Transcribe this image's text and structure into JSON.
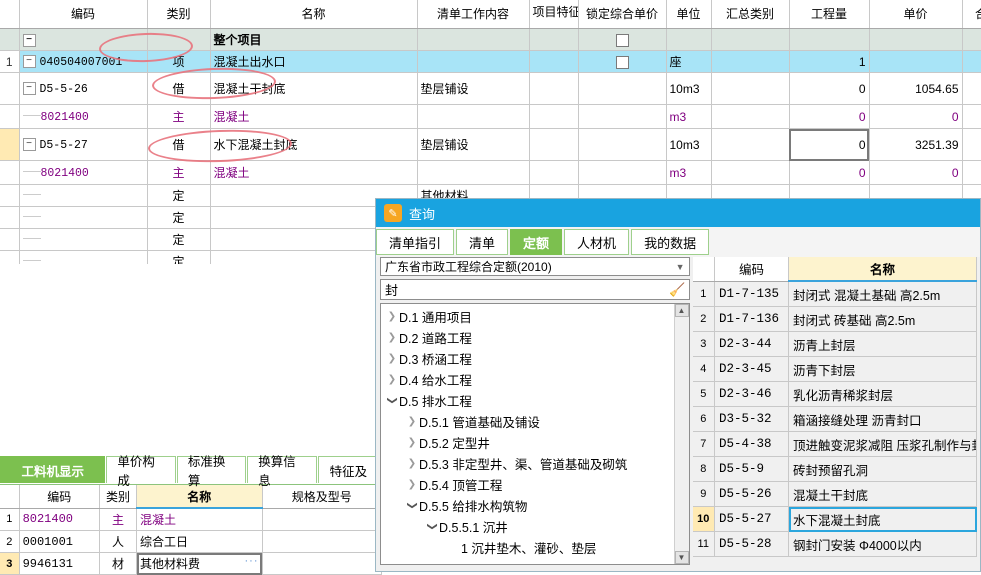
{
  "main_grid": {
    "columns": [
      "",
      "编码",
      "类别",
      "名称",
      "清单工作内容",
      "项目特征",
      "锁定综合单价",
      "单位",
      "汇总类别",
      "工程量",
      "单价",
      "合"
    ],
    "sorted_column": "工程量",
    "rows": [
      {
        "idx": "",
        "code": "",
        "cat": "",
        "name": "整个项目",
        "work": "",
        "unit": "",
        "qty": "",
        "price": "",
        "checkbox": true,
        "style": "total"
      },
      {
        "idx": "1",
        "code": "040504007001",
        "cat": "项",
        "name": "混凝土出水口",
        "work": "",
        "unit": "座",
        "qty": "1",
        "price": "",
        "checkbox": true,
        "style": "sel"
      },
      {
        "idx": "",
        "code": "D5-5-26",
        "cat": "借",
        "name": "混凝土干封底",
        "work": "垫层铺设",
        "unit": "10m3",
        "qty": "0",
        "price": "1054.65",
        "checkbox": false,
        "style": "sub1"
      },
      {
        "idx": "",
        "code": "8021400",
        "cat": "主",
        "name": "混凝土",
        "work": "",
        "unit": "m3",
        "qty": "0",
        "price": "0",
        "checkbox": false,
        "style": "purple"
      },
      {
        "idx": "",
        "code": "D5-5-27",
        "cat": "借",
        "name": "水下混凝土封底",
        "work": "垫层铺设",
        "unit": "10m3",
        "qty": "0",
        "price": "3251.39",
        "checkbox": false,
        "style": "sub1marker"
      },
      {
        "idx": "",
        "code": "8021400",
        "cat": "主",
        "name": "混凝土",
        "work": "",
        "unit": "m3",
        "qty": "0",
        "price": "0",
        "checkbox": false,
        "style": "purple"
      },
      {
        "idx": "",
        "code": "",
        "cat": "定",
        "name": "",
        "work": "其他材料",
        "unit": "",
        "qty": "",
        "price": "",
        "checkbox": false,
        "style": "empty"
      },
      {
        "idx": "",
        "code": "",
        "cat": "定",
        "name": "",
        "work": "",
        "unit": "",
        "qty": "",
        "price": "",
        "checkbox": false,
        "style": "empty"
      },
      {
        "idx": "",
        "code": "",
        "cat": "定",
        "name": "",
        "work": "",
        "unit": "",
        "qty": "",
        "price": "",
        "checkbox": false,
        "style": "empty"
      },
      {
        "idx": "",
        "code": "",
        "cat": "定",
        "name": "",
        "work": "",
        "unit": "",
        "qty": "",
        "price": "",
        "checkbox": false,
        "style": "empty"
      }
    ],
    "selected_cell_value": "0"
  },
  "annotations": {
    "ellipse_1_label": "circle-around-code-040504007001",
    "ellipse_2_label": "circle-around-混凝土干封底",
    "ellipse_3_label": "circle-around-水下混凝土封底"
  },
  "bottom_panel": {
    "tabs": [
      "工料机显示",
      "单价构成",
      "标准换算",
      "换算信息",
      "特征及"
    ],
    "active_tab": "工料机显示",
    "columns": [
      "",
      "编码",
      "类别",
      "名称",
      "规格及型号"
    ],
    "sorted_column": "名称",
    "rows": [
      {
        "idx": "1",
        "code": "8021400",
        "cat": "主",
        "name": "混凝土",
        "spec": "",
        "style": "purple"
      },
      {
        "idx": "2",
        "code": "0001001",
        "cat": "人",
        "name": "综合工日",
        "spec": "",
        "style": "normal"
      },
      {
        "idx": "3",
        "code": "9946131",
        "cat": "材",
        "name": "其他材料费",
        "spec": "",
        "style": "selected"
      }
    ],
    "ellipsis_button": "···"
  },
  "dialog": {
    "title": "查询",
    "icon": "pencil-note-icon",
    "tabs": [
      "清单指引",
      "清单",
      "定额",
      "人材机",
      "我的数据"
    ],
    "active_tab": "定额",
    "library_select": "广东省市政工程综合定额(2010)",
    "search_value": "封",
    "search_clear_icon": "broom-icon",
    "tree": [
      {
        "label": "D.1 通用项目",
        "level": 0,
        "state": "collapsed"
      },
      {
        "label": "D.2 道路工程",
        "level": 0,
        "state": "collapsed"
      },
      {
        "label": "D.3 桥涵工程",
        "level": 0,
        "state": "collapsed"
      },
      {
        "label": "D.4 给水工程",
        "level": 0,
        "state": "collapsed"
      },
      {
        "label": "D.5 排水工程",
        "level": 0,
        "state": "expanded"
      },
      {
        "label": "D.5.1 管道基础及铺设",
        "level": 1,
        "state": "collapsed"
      },
      {
        "label": "D.5.2 定型井",
        "level": 1,
        "state": "collapsed"
      },
      {
        "label": "D.5.3 非定型井、渠、管道基础及砌筑",
        "level": 1,
        "state": "collapsed"
      },
      {
        "label": "D.5.4 顶管工程",
        "level": 1,
        "state": "collapsed"
      },
      {
        "label": "D.5.5 给排水构筑物",
        "level": 1,
        "state": "expanded"
      },
      {
        "label": "D.5.5.1 沉井",
        "level": 2,
        "state": "expanded"
      },
      {
        "label": "1 沉井垫木、灌砂、垫层",
        "level": 3,
        "state": "leaf"
      }
    ],
    "results": {
      "columns": [
        "",
        "编码",
        "名称"
      ],
      "sorted_column": "名称",
      "selected_index": "10",
      "rows": [
        {
          "idx": "1",
          "code": "D1-7-135",
          "name": "封闭式 混凝土基础 高2.5m"
        },
        {
          "idx": "2",
          "code": "D1-7-136",
          "name": "封闭式 砖基础 高2.5m"
        },
        {
          "idx": "3",
          "code": "D2-3-44",
          "name": "沥青上封层"
        },
        {
          "idx": "4",
          "code": "D2-3-45",
          "name": "沥青下封层"
        },
        {
          "idx": "5",
          "code": "D2-3-46",
          "name": "乳化沥青稀浆封层"
        },
        {
          "idx": "6",
          "code": "D3-5-32",
          "name": "箱涵接缝处理 沥青封口"
        },
        {
          "idx": "7",
          "code": "D5-4-38",
          "name": "顶进触变泥浆减阻 压浆孔制作与封"
        },
        {
          "idx": "8",
          "code": "D5-5-9",
          "name": "砖封预留孔洞"
        },
        {
          "idx": "9",
          "code": "D5-5-26",
          "name": "混凝土干封底"
        },
        {
          "idx": "10",
          "code": "D5-5-27",
          "name": "水下混凝土封底"
        },
        {
          "idx": "11",
          "code": "D5-5-28",
          "name": "钢封门安装 Φ4000以内"
        }
      ]
    }
  },
  "colors": {
    "accent_blue": "#19a3e0",
    "selection_row": "#a8e4f7",
    "total_row": "#dbe5df",
    "tab_green": "#7cc04f",
    "sorted_header": "#fdf3ce",
    "marker_yellow": "#ffeab3",
    "purple_text": "#800080",
    "annotation_red": "#e8737d"
  }
}
